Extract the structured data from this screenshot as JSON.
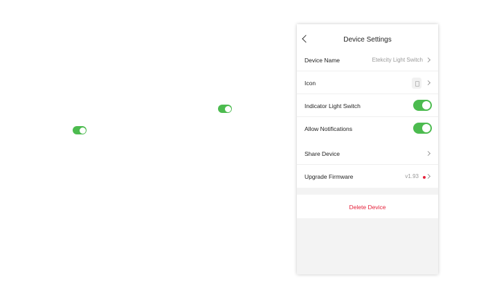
{
  "header": {
    "title": "Device Settings",
    "back_icon": "back-arrow-icon"
  },
  "settings": {
    "device_name": {
      "label": "Device Name",
      "value": "Etekcity Light Switch"
    },
    "icon": {
      "label": "Icon"
    },
    "indicator_light": {
      "label": "Indicator Light Switch",
      "on": true
    },
    "notifications": {
      "label": "Allow Notifications",
      "on": true
    }
  },
  "sharing": {
    "share_device": {
      "label": "Share Device"
    },
    "firmware": {
      "label": "Upgrade Firmware",
      "version": "v1.93",
      "update_available": true
    }
  },
  "danger": {
    "delete_label": "Delete Device"
  },
  "colors": {
    "toggle_on": "#4cbb4f",
    "danger": "#e5203a",
    "panel_bg": "#f3f3f3"
  }
}
